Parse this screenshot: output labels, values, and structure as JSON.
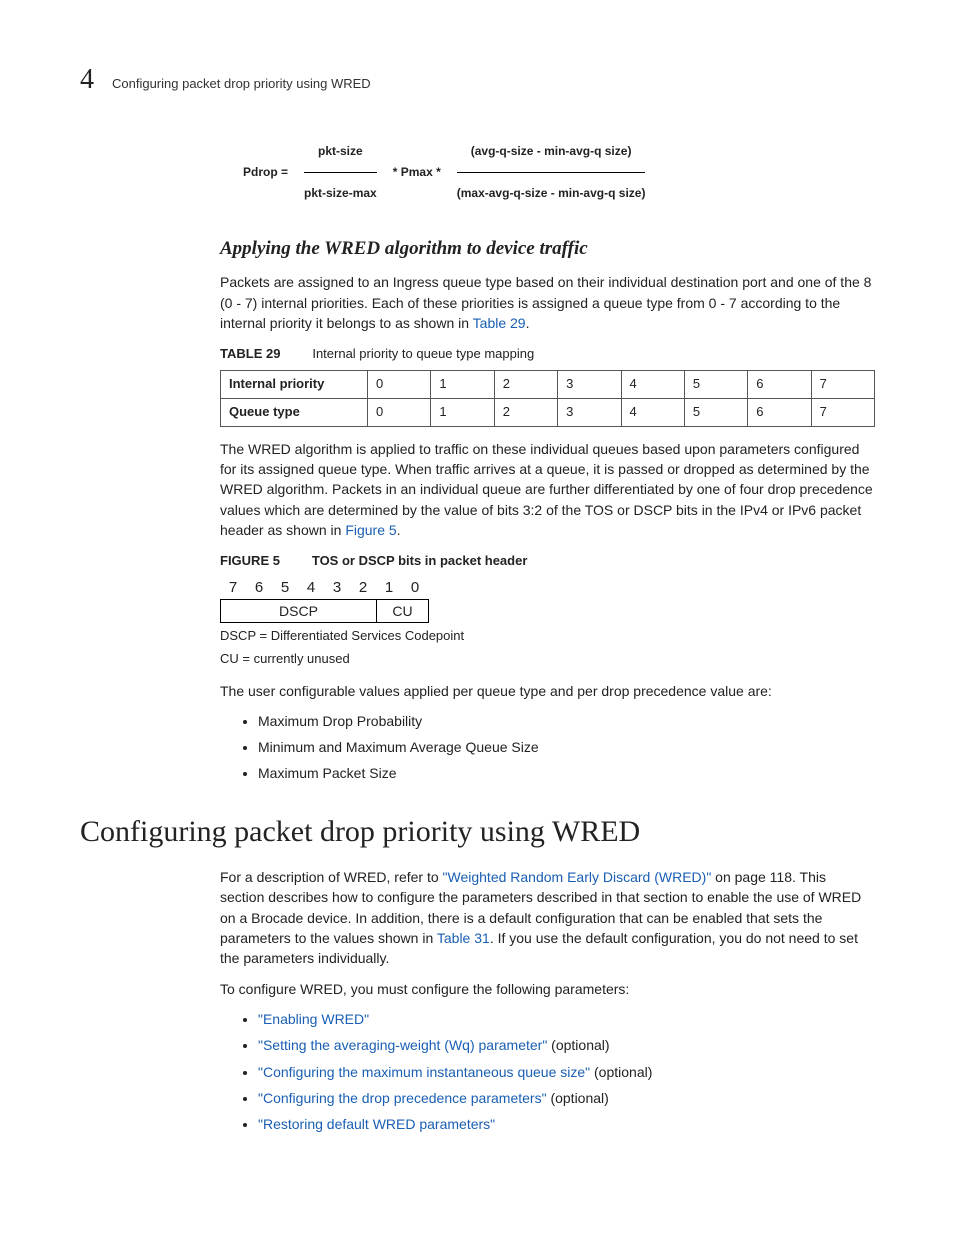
{
  "header": {
    "chapter_number": "4",
    "running_head": "Configuring packet drop priority using WRED"
  },
  "formula": {
    "lhs": "Pdrop =",
    "num_left": "pkt-size",
    "den_left": "pkt-size-max",
    "mid": "* Pmax *",
    "num_right": "(avg-q-size - min-avg-q size)",
    "den_right": "(max-avg-q-size - min-avg-q size)"
  },
  "sub_heading": "Applying the WRED algorithm to device traffic",
  "para1a": "Packets are assigned to an Ingress queue type based on their individual destination port and one of the 8 (0 - 7) internal priorities. Each of these priorities is assigned a queue type from 0 - 7 according to the internal priority it belongs to as shown in ",
  "para1_link": "Table 29",
  "para1b": ".",
  "table29": {
    "label": "TABLE 29",
    "caption": "Internal priority to queue type mapping",
    "row1_head": "Internal priority",
    "row2_head": "Queue type",
    "cols": [
      "0",
      "1",
      "2",
      "3",
      "4",
      "5",
      "6",
      "7"
    ]
  },
  "para2a": "The WRED algorithm is applied to traffic on these individual queues based upon parameters configured for its assigned queue type. When traffic arrives at a queue, it is passed or dropped as determined by the WRED algorithm. Packets in an individual queue are further differentiated by one of four drop precedence values which are determined by the value of bits 3:2 of the TOS or DSCP bits in the IPv4 or IPv6 packet header as shown in ",
  "para2_link": "Figure 5",
  "para2b": ".",
  "figure5": {
    "label": "FIGURE 5",
    "caption": "TOS or DSCP bits in packet header",
    "bits": [
      "7",
      "6",
      "5",
      "4",
      "3",
      "2",
      "1",
      "0"
    ],
    "dscp_label": "DSCP",
    "cu_label": "CU",
    "legend1": "DSCP = Differentiated Services Codepoint",
    "legend2": "CU = currently unused"
  },
  "para3": "The user configurable values applied per queue type and per drop precedence value are:",
  "bullets1": {
    "b1": "Maximum Drop Probability",
    "b2": "Minimum and Maximum Average Queue Size",
    "b3": "Maximum Packet Size"
  },
  "h1": "Configuring packet drop priority using WRED",
  "para4a": "For a description of WRED, refer to ",
  "para4_link": "\"Weighted Random Early Discard (WRED)\"",
  "para4b": " on page 118. This section describes how to configure the parameters described in that section to enable the use of WRED on a Brocade device. In addition, there is a default configuration that can be enabled that sets the parameters to the values shown in ",
  "para4_link2": "Table 31",
  "para4c": ". If you use the default configuration, you do not need to set the parameters individually.",
  "para5": "To configure WRED, you must configure the following parameters:",
  "bullets2": {
    "b1": "\"Enabling WRED\"",
    "b2": "\"Setting the averaging-weight (Wq) parameter\"",
    "b2_opt": " (optional)",
    "b3": "\"Configuring the maximum instantaneous queue size\"",
    "b3_opt": " (optional)",
    "b4": "\"Configuring the drop precedence parameters\"",
    "b4_opt": " (optional)",
    "b5": "\"Restoring default WRED parameters\""
  }
}
